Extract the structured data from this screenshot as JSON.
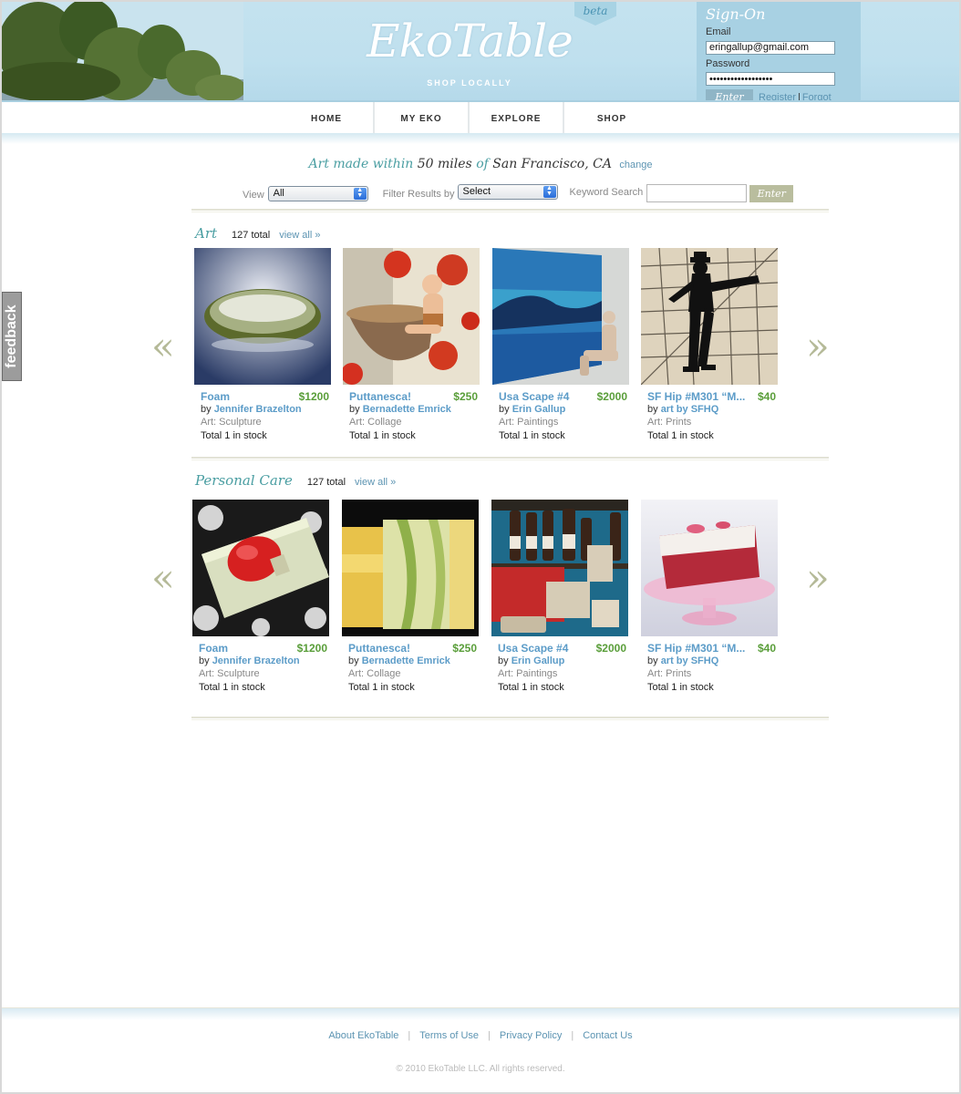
{
  "header": {
    "logo": "EkoTable",
    "tagline": "SHOP LOCALLY",
    "beta": "beta",
    "signon": {
      "title": "Sign-On",
      "email_label": "Email",
      "email_value": "eringallup@gmail.com",
      "password_label": "Password",
      "password_value": "••••••••••••••••••",
      "enter_label": "Enter",
      "register_label": "Register",
      "separator": "|",
      "forgot_label": "Forgot"
    }
  },
  "nav": [
    {
      "label": "HOME"
    },
    {
      "label": "MY EKO"
    },
    {
      "label": "EXPLORE"
    },
    {
      "label": "SHOP"
    }
  ],
  "location": {
    "prefix": "Art made within",
    "distance": "50 miles",
    "of": "of",
    "city": "San Francisco, CA",
    "change": "change"
  },
  "filters": {
    "view_label": "View",
    "view_value": "All",
    "filter_label": "Filter Results by",
    "filter_value": "Select",
    "keyword_label": "Keyword Search",
    "keyword_value": "",
    "enter_label": "Enter"
  },
  "arrows": {
    "prev": "«",
    "next": "»"
  },
  "sections": [
    {
      "title": "Art",
      "total": "127 total",
      "view_all": "view all »",
      "items": [
        {
          "title": "Foam",
          "price": "$1200",
          "by": "by",
          "artist": "Jennifer Brazelton",
          "category": "Art: Sculpture",
          "stock": "Total 1 in stock"
        },
        {
          "title": "Puttanesca!",
          "price": "$250",
          "by": "by",
          "artist": "Bernadette Emrick",
          "category": "Art: Collage",
          "stock": "Total 1 in stock"
        },
        {
          "title": "Usa Scape #4",
          "price": "$2000",
          "by": "by",
          "artist": "Erin Gallup",
          "category": "Art: Paintings",
          "stock": "Total 1 in stock"
        },
        {
          "title": "SF Hip #M301 “M...",
          "price": "$40",
          "by": "by",
          "artist": "art by SFHQ",
          "category": "Art: Prints",
          "stock": "Total 1 in stock"
        }
      ]
    },
    {
      "title": "Personal Care",
      "total": "127 total",
      "view_all": "view all »",
      "items": [
        {
          "title": "Foam",
          "price": "$1200",
          "by": "by",
          "artist": "Jennifer Brazelton",
          "category": "Art: Sculpture",
          "stock": "Total 1 in stock"
        },
        {
          "title": "Puttanesca!",
          "price": "$250",
          "by": "by",
          "artist": "Bernadette Emrick",
          "category": "Art: Collage",
          "stock": "Total 1 in stock"
        },
        {
          "title": "Usa Scape #4",
          "price": "$2000",
          "by": "by",
          "artist": "Erin Gallup",
          "category": "Art: Paintings",
          "stock": "Total 1 in stock"
        },
        {
          "title": "SF Hip #M301 “M...",
          "price": "$40",
          "by": "by",
          "artist": "art by SFHQ",
          "category": "Art: Prints",
          "stock": "Total 1 in stock"
        }
      ]
    }
  ],
  "feedback": "feedback",
  "footer": {
    "links": [
      {
        "label": "About EkoTable"
      },
      {
        "label": "Terms of Use"
      },
      {
        "label": "Privacy Policy"
      },
      {
        "label": "Contact Us"
      }
    ],
    "copyright": "© 2010 EkoTable LLC. All rights reserved."
  },
  "colors": {
    "header_bg": "#c4e2ef",
    "teal_accent": "#4a9ea2",
    "link_blue": "#5c9cc8",
    "price_green": "#5a9e3a",
    "olive_button": "#b9bd9e"
  }
}
